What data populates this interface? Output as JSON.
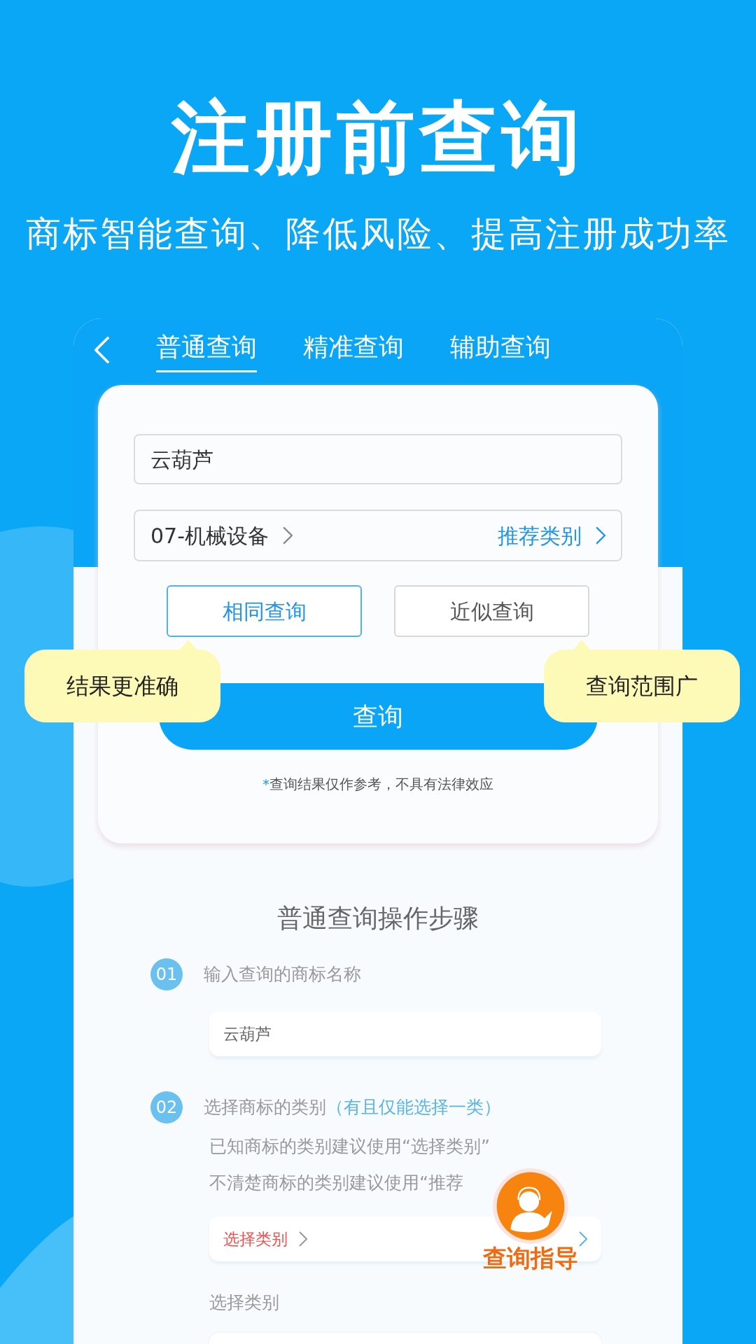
{
  "headline": "注册前查询",
  "subheadline": "商标智能查询、降低风险、提高注册成功率",
  "tabs": [
    {
      "label": "普通查询",
      "selected": true
    },
    {
      "label": "精准查询",
      "selected": false
    },
    {
      "label": "辅助查询",
      "selected": false
    }
  ],
  "search": {
    "value": "云葫芦",
    "category": "07-机械设备",
    "recommend": "推荐类别"
  },
  "modes": [
    {
      "label": "相同查询",
      "selected": true,
      "tip": "结果更准确"
    },
    {
      "label": "近似查询",
      "selected": false,
      "tip": "查询范围广"
    }
  ],
  "query_button": "查询",
  "note": {
    "mark": "*",
    "text": "查询结果仅作参考，不具有法律效应"
  },
  "steps_title": "普通查询操作步骤",
  "steps": [
    {
      "number": "01",
      "title": "输入查询的商标名称",
      "example": "云葫芦"
    },
    {
      "number": "02",
      "title": "选择商标的类别",
      "hint": "（有且仅能选择一类）",
      "lines": [
        "已知商标的类别建议使用“选择类别”",
        "不清楚商标的类别建议使用“推荐"
      ],
      "choose": "选择类别"
    }
  ],
  "choose_label": "选择类别",
  "guide": {
    "label": "查询指导"
  }
}
